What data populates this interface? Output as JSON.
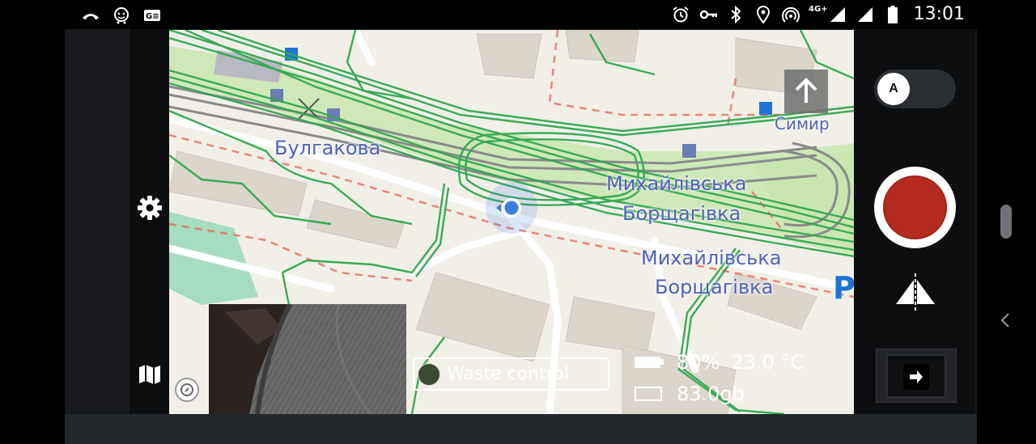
{
  "status_bar": {
    "time": "13:01",
    "network": "4G+",
    "left_icons": [
      "missed-call-icon",
      "waze-icon",
      "ge-icon"
    ],
    "right_icons": [
      "alarm-icon",
      "vpn-key-icon",
      "bluetooth-icon",
      "location-icon",
      "hotspot-icon",
      "signal-icon",
      "signal-icon",
      "battery-icon"
    ]
  },
  "map": {
    "labels": {
      "bulgakova": "Булгакова",
      "mykhailivska_1": "Михайлівська",
      "borshchahivka_1": "Борщагівка",
      "mykhailivska_2": "Михайлівська",
      "borshchahivka_2": "Борщагівка",
      "symyr": "Симир"
    },
    "track_color": "#2fa84f",
    "location_color": "#3b7ddd"
  },
  "overlay": {
    "channel_name": "Waste control",
    "battery": "80%",
    "temperature": "23.0 °C",
    "storage": "83.0gb"
  },
  "controls": {
    "auto_mode_letter": "A",
    "record_color": "#b52a1e"
  }
}
